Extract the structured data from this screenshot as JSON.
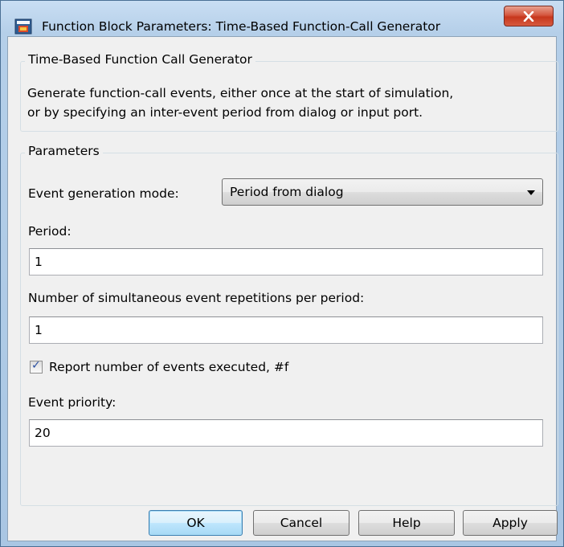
{
  "window": {
    "title": "Function Block Parameters: Time-Based Function-Call Generator"
  },
  "description_group": {
    "legend": "Time-Based Function Call Generator",
    "lines": [
      "Generate function-call events, either once at the start of simulation,",
      "or by specifying an inter-event period from dialog or input port."
    ]
  },
  "parameters_group": {
    "legend": "Parameters",
    "event_mode": {
      "label": "Event generation mode:",
      "value": "Period from dialog"
    },
    "period": {
      "label": "Period:",
      "value": "1"
    },
    "repetitions": {
      "label": "Number of simultaneous event repetitions per period:",
      "value": "1"
    },
    "report_events": {
      "label": "Report number of events executed, #f",
      "checked": true
    },
    "priority": {
      "label": "Event priority:",
      "value": "20"
    }
  },
  "buttons": {
    "ok": "OK",
    "cancel": "Cancel",
    "help": "Help",
    "apply": "Apply"
  },
  "colors": {
    "close_button": "#c7371d",
    "checkmark": "#2b4fa0"
  }
}
